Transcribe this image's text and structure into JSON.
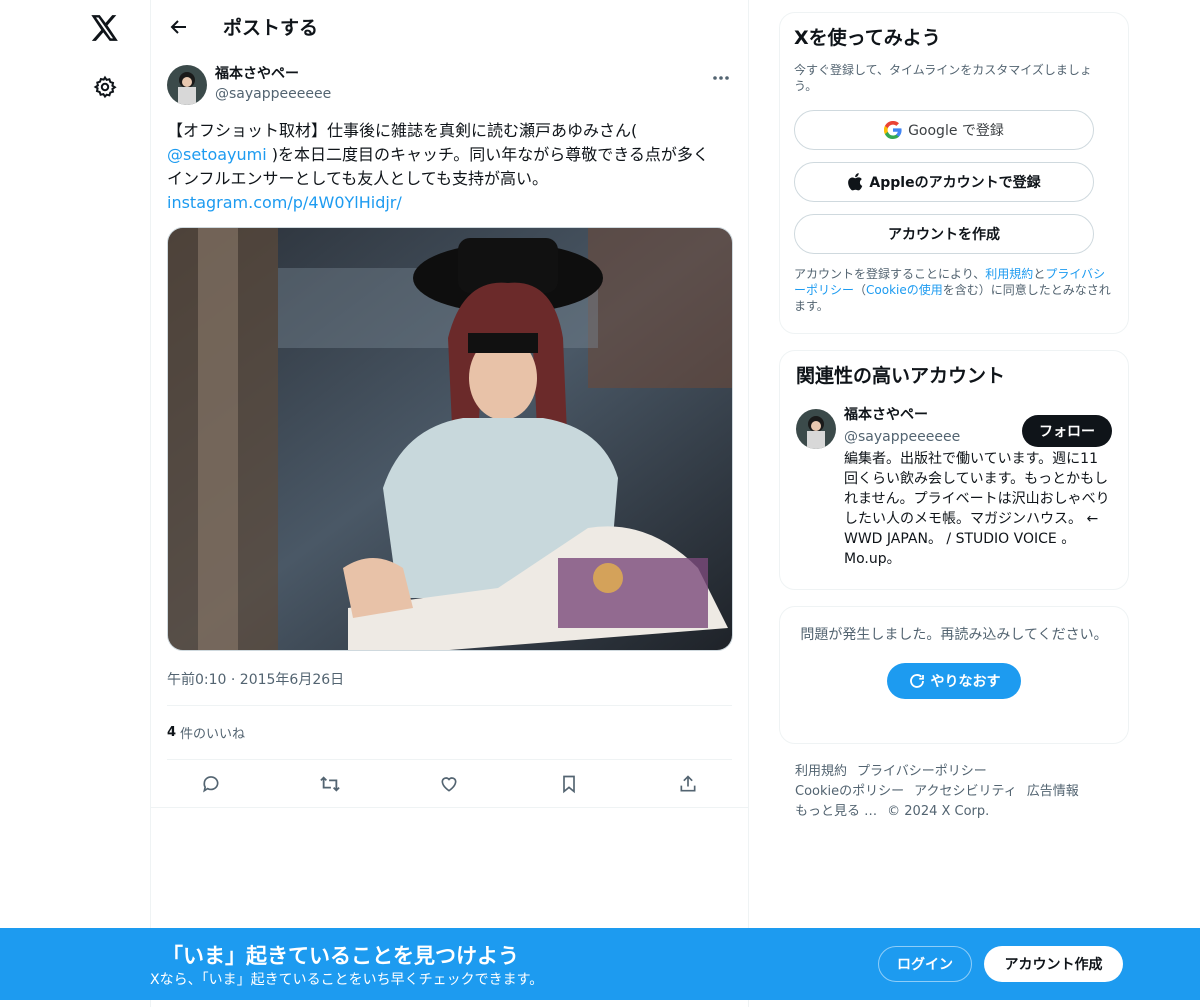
{
  "header": {
    "title": "ポストする"
  },
  "tweet": {
    "author_name": "福本さやペー",
    "author_handle": "@sayappeeeeee",
    "text_line1": "【オフショット取材】仕事後に雑誌を真剣に読む瀬戸あゆみさん(",
    "mention": "@setoayumi",
    "text_line2_rest": " )を本日二度目のキャッチ。同い年ながら尊敬できる点が多く",
    "text_line3": "インフルエンサーとしても友人としても支持が高い。",
    "link": "instagram.com/p/4W0YlHidjr/",
    "timestamp": "午前0:10 · 2015年6月26日",
    "likes_count": "4",
    "likes_label": "件のいいね"
  },
  "signup": {
    "title": "Xを使ってみよう",
    "subtitle": "今すぐ登録して、タイムラインをカスタマイズしましょう。",
    "google_label": "Google で登録",
    "apple_label": "Appleのアカウントで登録",
    "create_label": "アカウントを作成",
    "legal_a": "アカウントを登録することにより、",
    "legal_terms": "利用規約",
    "legal_b": "と",
    "legal_privacy": "プライバシーポリシー",
    "legal_c": "（",
    "legal_cookie": "Cookieの使用",
    "legal_d": "を含む）に同意したとみなされます。"
  },
  "related": {
    "title": "関連性の高いアカウント",
    "name": "福本さやペー",
    "handle": "@sayappeeeeee",
    "follow_label": "フォロー",
    "bio": "編集者。出版社で働いています。週に11回くらい飲み会しています。もっとかもしれません。プライベートは沢山おしゃべりしたい人のメモ帳。マガジンハウス。 ← WWD JAPAN。 / STUDIO VOICE 。Mo.up。"
  },
  "error": {
    "text": "問題が発生しました。再読み込みしてください。",
    "retry_label": "やりなおす"
  },
  "footer": {
    "terms": "利用規約",
    "privacy": "プライバシーポリシー",
    "cookie": "Cookieのポリシー",
    "accessibility": "アクセシビリティ",
    "ads": "広告情報",
    "more": "もっと見る …",
    "copyright": "© 2024 X Corp."
  },
  "banner": {
    "title": "「いま」起きていることを見つけよう",
    "subtitle": "Xなら、「いま」起きていることをいち早くチェックできます。",
    "login_label": "ログイン",
    "signup_label": "アカウント作成"
  },
  "colors": {
    "accent": "#1d9bf0",
    "text": "#0f1419",
    "muted": "#536471"
  }
}
